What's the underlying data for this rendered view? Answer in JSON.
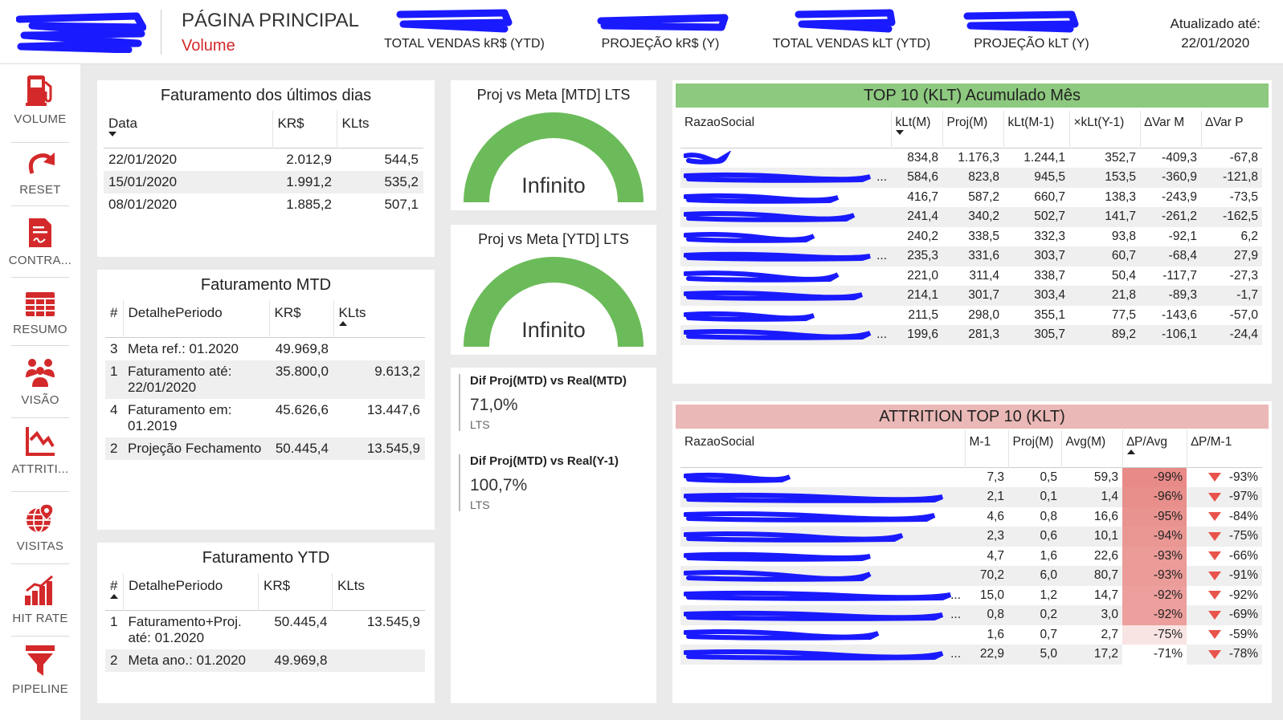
{
  "header": {
    "page_title": "PÁGINA PRINCIPAL",
    "page_subtitle": "Volume",
    "kpis": [
      {
        "label": "TOTAL VENDAS kR$ (YTD)"
      },
      {
        "label": "PROJEÇÃO kR$ (Y)"
      },
      {
        "label": "TOTAL VENDAS kLT (YTD)"
      },
      {
        "label": "PROJEÇÃO kLT (Y)"
      }
    ],
    "updated_label": "Atualizado até:",
    "updated_date": "22/01/2020",
    "redaction_color": "#1a1aff"
  },
  "sidebar": {
    "items": [
      {
        "label": "VOLUME",
        "icon": "fuel-pump-icon"
      },
      {
        "label": "RESET",
        "icon": "redo-arrow-icon"
      },
      {
        "label": "CONTRA...",
        "icon": "contract-icon"
      },
      {
        "label": "RESUMO",
        "icon": "grid-table-icon"
      },
      {
        "label": "VISÃO",
        "icon": "people-group-icon"
      },
      {
        "label": "ATTRITI...",
        "icon": "line-chart-icon"
      },
      {
        "label": "VISITAS",
        "icon": "globe-pin-icon"
      },
      {
        "label": "HIT RATE",
        "icon": "bar-chart-icon"
      },
      {
        "label": "PIPELINE",
        "icon": "funnel-icon"
      }
    ],
    "accent": "#d3292a"
  },
  "ultimos_dias": {
    "title": "Faturamento dos últimos dias",
    "headers": [
      "Data",
      "KR$",
      "KLts"
    ],
    "rows": [
      [
        "22/01/2020",
        "2.012,9",
        "544,5"
      ],
      [
        "15/01/2020",
        "1.991,2",
        "535,2"
      ],
      [
        "08/01/2020",
        "1.885,2",
        "507,1"
      ]
    ]
  },
  "mtd": {
    "title": "Faturamento MTD",
    "headers": [
      "#",
      "DetalhePeriodo",
      "KR$",
      "KLts"
    ],
    "rows": [
      [
        "3",
        "Meta ref.: 01.2020",
        "49.969,8",
        ""
      ],
      [
        "1",
        "Faturamento até: 22/01/2020",
        "35.800,0",
        "9.613,2"
      ],
      [
        "4",
        "Faturamento em: 01.2019",
        "45.626,6",
        "13.447,6"
      ],
      [
        "2",
        "Projeção Fechamento",
        "50.445,4",
        "13.545,9"
      ]
    ]
  },
  "ytd": {
    "title": "Faturamento YTD",
    "headers": [
      "#",
      "DetalhePeriodo",
      "KR$",
      "KLts"
    ],
    "rows": [
      [
        "1",
        "Faturamento+Proj. até: 01.2020",
        "50.445,4",
        "13.545,9"
      ],
      [
        "2",
        "Meta ano.: 01.2020",
        "49.969,8",
        ""
      ]
    ]
  },
  "gauges": [
    {
      "title": "Proj vs Meta [MTD] LTS",
      "value_text": "Infinito",
      "fill": 1.0,
      "color": "#6cbb5a"
    },
    {
      "title": "Proj vs Meta [YTD] LTS",
      "value_text": "Infinito",
      "fill": 1.0,
      "color": "#6cbb5a"
    }
  ],
  "dif": [
    {
      "title": "Dif Proj(MTD) vs Real(MTD)",
      "value": "71,0%",
      "unit": "LTS"
    },
    {
      "title": "Dif Proj(MTD) vs Real(Y-1)",
      "value": "100,7%",
      "unit": "LTS"
    }
  ],
  "top10": {
    "title": "TOP 10 (KLT) Acumulado Mês",
    "band_color": "#8dc97f",
    "headers": [
      "RazaoSocial",
      "kLt(M)",
      "Proj(M)",
      "kLt(M-1)",
      "×kLt(Y-1)",
      "∆Var M",
      "∆Var P"
    ],
    "rows": [
      [
        "",
        "834,8",
        "1.176,3",
        "1.244,1",
        "352,7",
        "-409,3",
        "-67,8"
      ],
      [
        "...",
        "584,6",
        "823,8",
        "945,5",
        "153,5",
        "-360,9",
        "-121,8"
      ],
      [
        "",
        "416,7",
        "587,2",
        "660,7",
        "138,3",
        "-243,9",
        "-73,5"
      ],
      [
        "",
        "241,4",
        "340,2",
        "502,7",
        "141,7",
        "-261,2",
        "-162,5"
      ],
      [
        "",
        "240,2",
        "338,5",
        "332,3",
        "93,8",
        "-92,1",
        "6,2"
      ],
      [
        "...",
        "235,3",
        "331,6",
        "303,7",
        "60,7",
        "-68,4",
        "27,9"
      ],
      [
        "",
        "221,0",
        "311,4",
        "338,7",
        "50,4",
        "-117,7",
        "-27,3"
      ],
      [
        "",
        "214,1",
        "301,7",
        "303,4",
        "21,8",
        "-89,3",
        "-1,7"
      ],
      [
        "",
        "211,5",
        "298,0",
        "355,1",
        "77,5",
        "-143,6",
        "-57,0"
      ],
      [
        "...",
        "199,6",
        "281,3",
        "305,7",
        "89,2",
        "-106,1",
        "-24,4"
      ]
    ]
  },
  "attrition": {
    "title": "ATTRITION TOP 10 (KLT)",
    "band_color": "#eab8b6",
    "headers": [
      "RazaoSocial",
      "M-1",
      "Proj(M)",
      "Avg(M)",
      "∆P/Avg",
      "∆P/M-1"
    ],
    "rows": [
      [
        "",
        "7,3",
        "0,5",
        "59,3",
        "-99%",
        "-93%",
        "#e88a87"
      ],
      [
        "",
        "2,1",
        "0,1",
        "1,4",
        "-96%",
        "-97%",
        "#e88f8c"
      ],
      [
        "",
        "4,6",
        "0,8",
        "16,6",
        "-95%",
        "-84%",
        "#e99390"
      ],
      [
        "",
        "2,3",
        "0,6",
        "10,1",
        "-94%",
        "-75%",
        "#ea9794"
      ],
      [
        "",
        "4,7",
        "1,6",
        "22,6",
        "-93%",
        "-66%",
        "#eb9b98"
      ],
      [
        "",
        "70,2",
        "6,0",
        "80,7",
        "-93%",
        "-91%",
        "#eb9b98"
      ],
      [
        "...",
        "15,0",
        "1,2",
        "14,7",
        "-92%",
        "-92%",
        "#ec9f9c"
      ],
      [
        "...",
        "0,8",
        "0,2",
        "3,0",
        "-92%",
        "-69%",
        "#ec9f9c"
      ],
      [
        "",
        "1,6",
        "0,7",
        "2,7",
        "-75%",
        "-59%",
        "#f8e4e3"
      ],
      [
        "...",
        "22,9",
        "5,0",
        "17,2",
        "-71%",
        "-78%",
        "#ffffff"
      ]
    ]
  }
}
